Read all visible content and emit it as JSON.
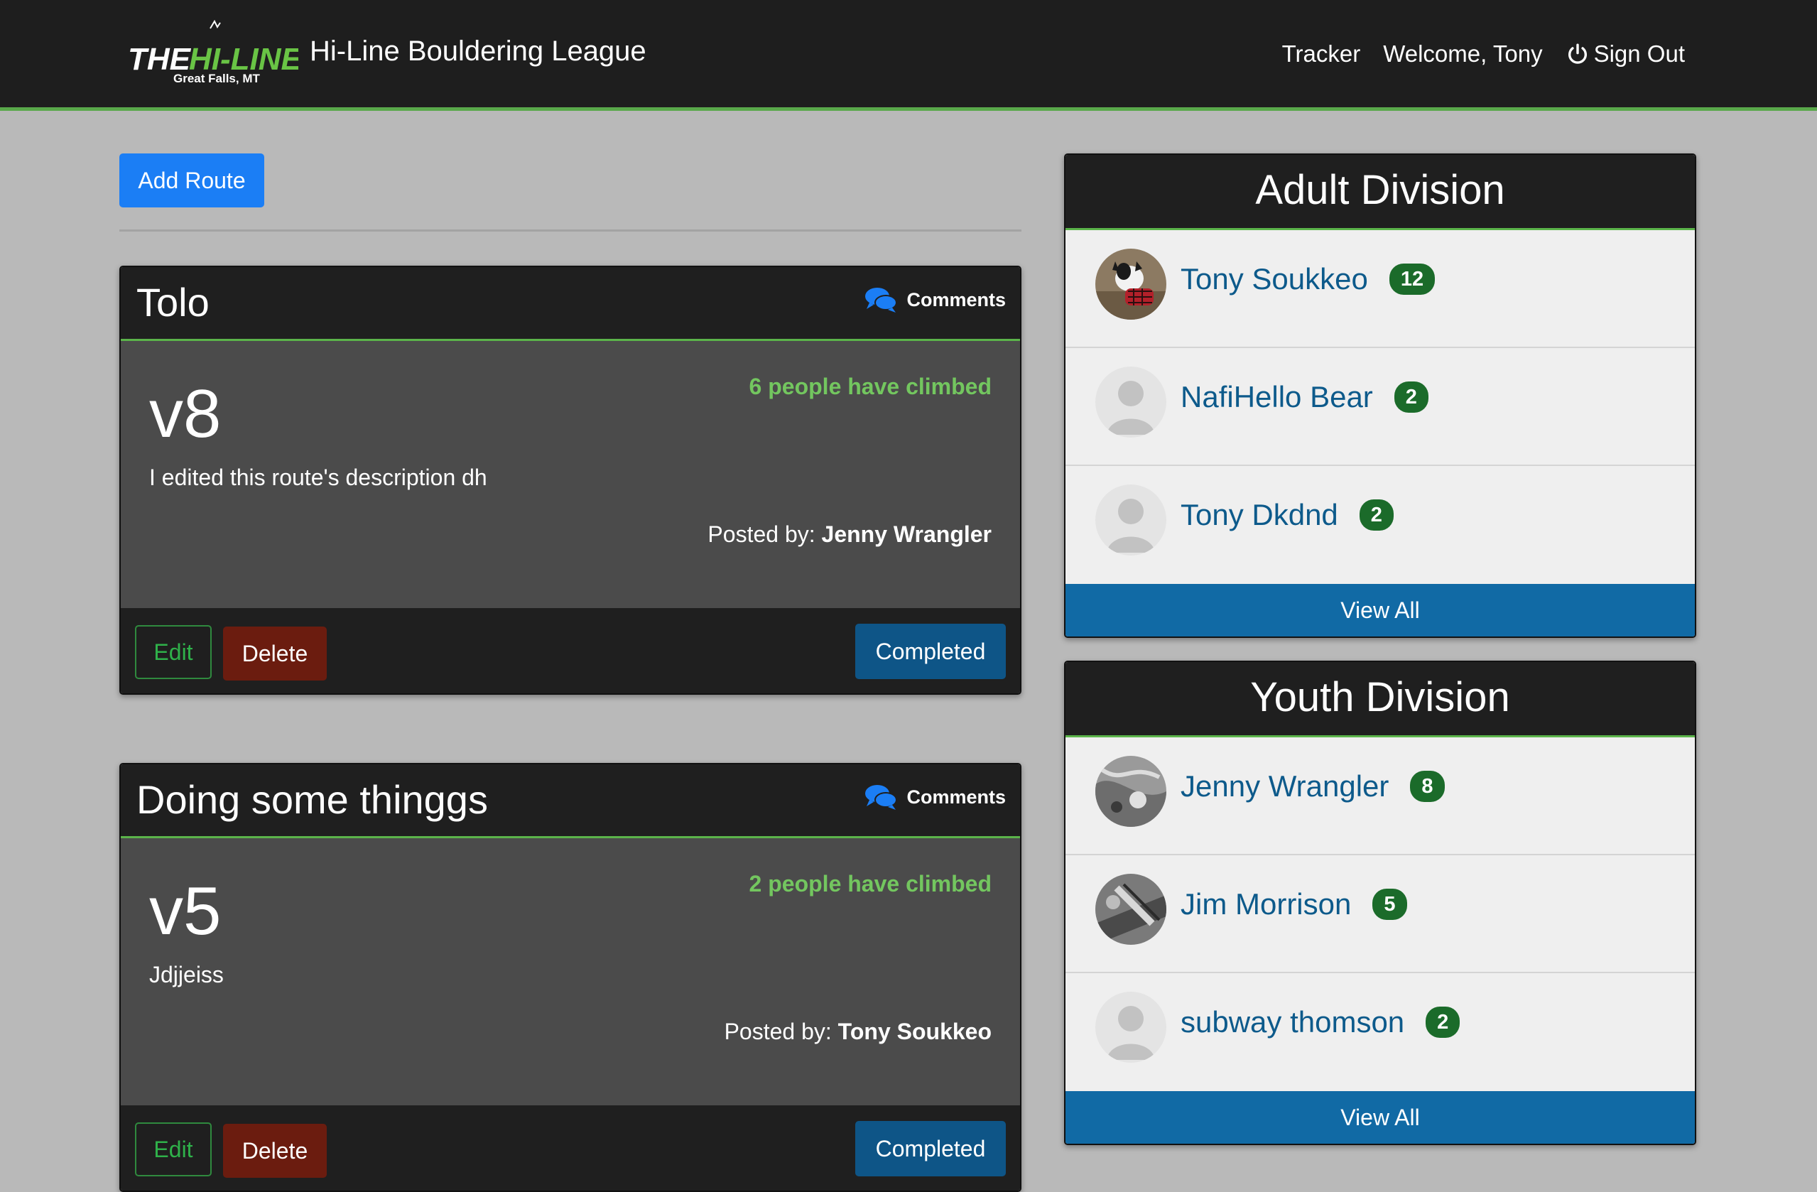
{
  "nav": {
    "logo_text_main": "THE HI-LINE",
    "logo_text_sub": "Great Falls, MT",
    "site_title": "Hi-Line Bouldering League",
    "tracker": "Tracker",
    "welcome": "Welcome, Tony",
    "sign_out": "Sign Out"
  },
  "add_route_label": "Add Route",
  "routes": [
    {
      "name": "Tolo",
      "comments_label": "Comments",
      "grade": "v8",
      "climbed": "6 people have climbed",
      "description": "I edited this route's description dh",
      "posted_by_label": "Posted by:",
      "posted_by": "Jenny Wrangler",
      "edit": "Edit",
      "delete": "Delete",
      "completed": "Completed"
    },
    {
      "name": "Doing some thinggs",
      "comments_label": "Comments",
      "grade": "v5",
      "climbed": "2 people have climbed",
      "description": "Jdjjeiss",
      "posted_by_label": "Posted by:",
      "posted_by": "Tony Soukkeo",
      "edit": "Edit",
      "delete": "Delete",
      "completed": "Completed"
    }
  ],
  "divisions": [
    {
      "title": "Adult Division",
      "leaders": [
        {
          "name": "Tony Soukkeo",
          "score": "12",
          "avatar": "dog-photo"
        },
        {
          "name": "NafiHello Bear",
          "score": "2",
          "avatar": "default-user"
        },
        {
          "name": "Tony Dkdnd",
          "score": "2",
          "avatar": "default-user"
        }
      ],
      "view_all": "View All"
    },
    {
      "title": "Youth Division",
      "leaders": [
        {
          "name": "Jenny Wrangler",
          "score": "8",
          "avatar": "grayscale-photo"
        },
        {
          "name": "Jim Morrison",
          "score": "5",
          "avatar": "grayscale-photo"
        },
        {
          "name": "subway thomson",
          "score": "2",
          "avatar": "default-user"
        }
      ],
      "view_all": "View All"
    }
  ],
  "colors": {
    "navbar_bg": "#1e1e1e",
    "accent_green": "#5bb44a",
    "primary_blue": "#1b7ef5",
    "completed_blue": "#0e5587",
    "delete_red": "#6b1c0f",
    "badge_green": "#1b6b2a",
    "leader_link": "#0d5a8b"
  }
}
